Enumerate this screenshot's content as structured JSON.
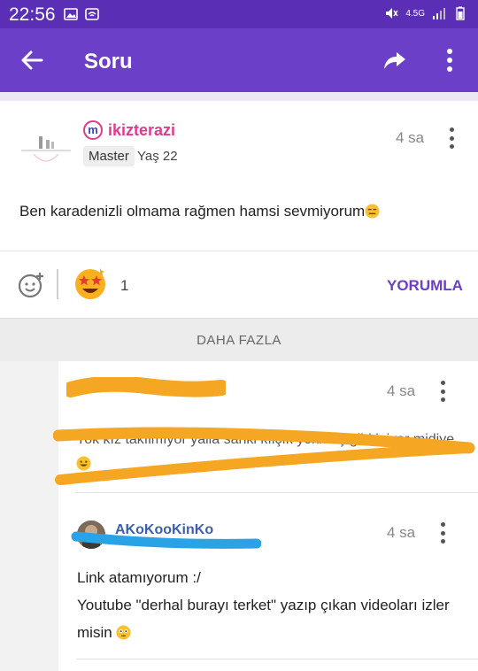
{
  "status_bar": {
    "time": "22:56",
    "network": "4.5G"
  },
  "app_bar": {
    "title": "Soru"
  },
  "question": {
    "username": "ikizterazi",
    "logo_letter": "m",
    "badge": "Master",
    "age": "Yaş 22",
    "time": "4 sa",
    "text": "Ben karadenizli olmama rağmen hamsi sevmiyorum"
  },
  "reactions": {
    "count": "1",
    "comment_label": "YORUMLA"
  },
  "more_label": "DAHA FAZLA",
  "comments": [
    {
      "time": "4 sa",
      "text": "Yok kız takılmıyor yalla sanki kılçık yokmuş gibi iniyor midiye"
    },
    {
      "name": "AKoKooKinKo",
      "time": "4 sa",
      "text": "Link atamıyorum :/\nYoutube \"derhal burayı terket\" yazıp çıkan videoları izler misin"
    }
  ],
  "colors": {
    "brand": "#6c3fc9",
    "status_bar": "#5a2fb5",
    "username": "#e03b8c",
    "scribble_orange": "#f5a623",
    "scribble_blue": "#2aa3e6"
  }
}
